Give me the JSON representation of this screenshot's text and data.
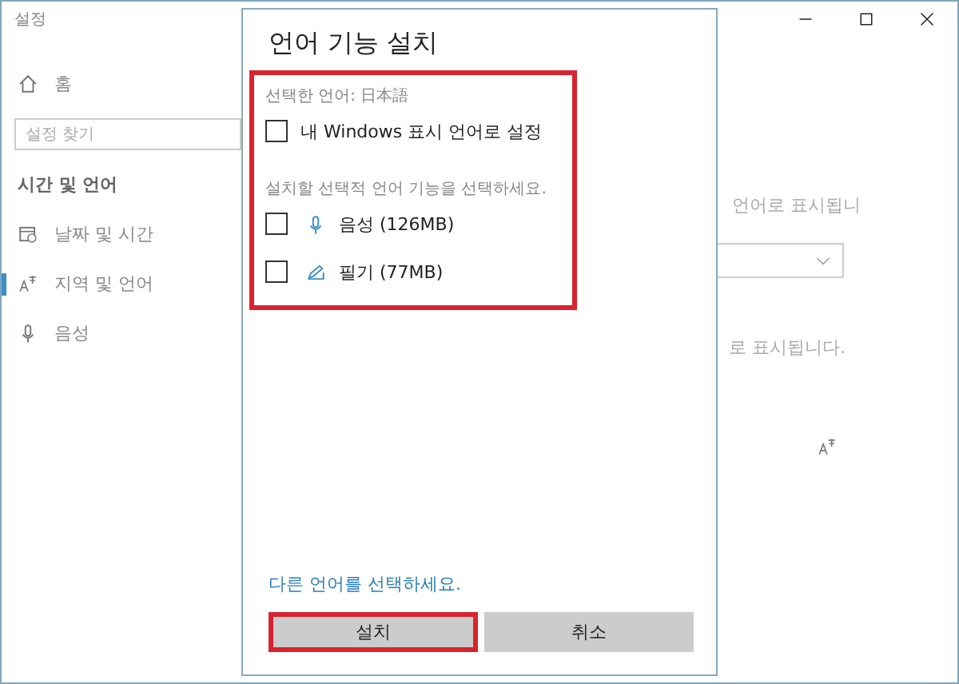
{
  "window": {
    "title": "설정"
  },
  "sidebar": {
    "home": "홈",
    "search": {
      "placeholder": "설정 찾기"
    },
    "section": "시간 및 언어",
    "items": [
      {
        "label": "날짜 및 시간",
        "selected": false
      },
      {
        "label": "지역 및 언어",
        "selected": true
      },
      {
        "label": "음성",
        "selected": false
      }
    ]
  },
  "content": {
    "text_1": "언어로 표시됩니",
    "text_2": "로 표시됩니다."
  },
  "dialog": {
    "title": "언어 기능 설치",
    "highlighted": true,
    "selected_language": "선택한 언어: 日本語",
    "display_option": {
      "label": "내 Windows 표시 언어로 설정",
      "checked": false
    },
    "hint": "설치할 선택적 언어 기능을 선택하세요.",
    "features": [
      {
        "label": "음성 (126MB)",
        "checked": false
      },
      {
        "label": "필기 (77MB)",
        "checked": false
      }
    ],
    "link": "다른 언어를 선택하세요.",
    "buttons": [
      {
        "label": "설치",
        "highlighted": true
      },
      {
        "label": "취소",
        "highlighted": false
      }
    ]
  }
}
